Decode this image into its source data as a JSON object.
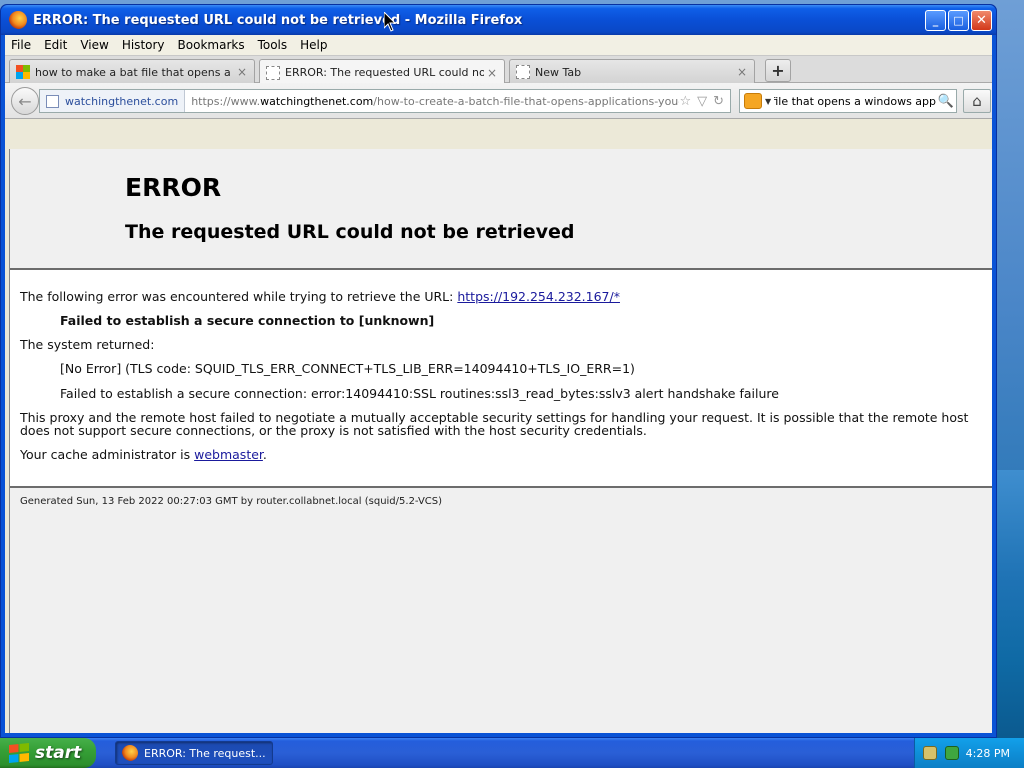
{
  "window": {
    "title": "ERROR: The requested URL could not be retrieved - Mozilla Firefox",
    "controls": {
      "minimize": "_",
      "maximize": "□",
      "close": "✕"
    }
  },
  "menu": [
    "File",
    "Edit",
    "View",
    "History",
    "Bookmarks",
    "Tools",
    "Help"
  ],
  "tabs": [
    {
      "label": "how to make a bat file that opens a wind...",
      "icon": "microsoft-icon",
      "close": "×"
    },
    {
      "label": "ERROR: The requested URL could not be...",
      "icon": "blank-page-icon",
      "close": "×",
      "active": true
    },
    {
      "label": "New Tab",
      "icon": "blank-page-icon",
      "close": "×"
    }
  ],
  "new_tab_button": "+",
  "nav": {
    "back": "←",
    "site_identity": "watchingthenet.com",
    "url_prefix": "https://www.",
    "url_domain": "watchingthenet.com",
    "url_path": "/how-to-create-a-batch-file-that-opens-applications-you-choose-fro",
    "star": "☆",
    "dropdown": "▽",
    "reload": "↻",
    "search_text": "bat file that opens a windows app",
    "search_button": "🔍",
    "search_dropdown": "▼",
    "home": "⌂"
  },
  "page": {
    "heading": "ERROR",
    "subheading": "The requested URL could not be retrieved",
    "line1_prefix": "The following error was encountered while trying to retrieve the URL: ",
    "line1_link": "https://192.254.232.167/*",
    "bold_message": "Failed to establish a secure connection to [unknown]",
    "system_returned": "The system returned:",
    "tls_code": "[No Error] (TLS code: SQUID_TLS_ERR_CONNECT+TLS_LIB_ERR=14094410+TLS_IO_ERR=1)",
    "ssl_error": "Failed to establish a secure connection: error:14094410:SSL routines:ssl3_read_bytes:sslv3 alert handshake failure",
    "explanation": "This proxy and the remote host failed to negotiate a mutually acceptable security settings for handling your request. It is possible that the remote host does not support secure connections, or the proxy is not satisfied with the host security credentials.",
    "admin_prefix": "Your cache administrator is ",
    "admin_link": "webmaster",
    "admin_suffix": ".",
    "footer": "Generated Sun, 13 Feb 2022 00:27:03 GMT by router.collabnet.local (squid/5.2-VCS)"
  },
  "taskbar": {
    "start_label": "start",
    "task_label": "ERROR: The request...",
    "clock": "4:28 PM"
  },
  "colors": {
    "titlebar": "#0a4fd6",
    "link": "#1a1a9c",
    "start_green": "#36a037"
  }
}
